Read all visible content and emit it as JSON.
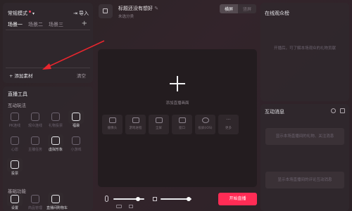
{
  "scene": {
    "title": "常规模式",
    "import_label": "导入",
    "tabs": [
      "场景一",
      "场景二",
      "场景三"
    ],
    "add_material": "+ 添加素材",
    "clear": "清空"
  },
  "tools": {
    "title": "直播工具",
    "interactive_title": "互动玩法",
    "interactive": [
      {
        "label": "PK连线",
        "active": false
      },
      {
        "label": "观众连线",
        "active": false
      },
      {
        "label": "礼物投票",
        "active": false
      },
      {
        "label": "福袋",
        "active": true
      },
      {
        "label": "心愿",
        "active": false
      },
      {
        "label": "主播任务",
        "active": false
      },
      {
        "label": "虚拟形象",
        "active": true
      },
      {
        "label": "小游戏",
        "active": false
      },
      {
        "label": "投票",
        "active": true
      }
    ],
    "basic_title": "基础功能",
    "basic": [
      {
        "label": "设置",
        "active": true
      },
      {
        "label": "商品管理",
        "active": false
      },
      {
        "label": "直播间购物车",
        "active": true
      }
    ]
  },
  "room": {
    "title": "标题还没有想好",
    "edit_icon": "edit-icon",
    "category": "未选分类",
    "orientation": [
      "横屏",
      "竖屏"
    ],
    "orientation_active": 0
  },
  "canvas": {
    "add_source": "添加直播画面",
    "sources": [
      "摄像头",
      "游戏进程",
      "全屏",
      "窗口",
      "投屏(iOS)",
      "更多"
    ]
  },
  "bottom": {
    "go_live": "开始直播",
    "mic_level": 0.8,
    "speaker_level": 0.9
  },
  "viewers": {
    "title": "在线观众榜",
    "empty": "开播后，可了解本场观众的礼物贡献"
  },
  "messages": {
    "title": "互动消息",
    "placeholder1": "显示本场直播间的礼物、关注消息",
    "placeholder2": "显示本场直播间的评论互动消息"
  },
  "colors": {
    "accent": "#ff2c55",
    "annotation": "#e8262e"
  }
}
